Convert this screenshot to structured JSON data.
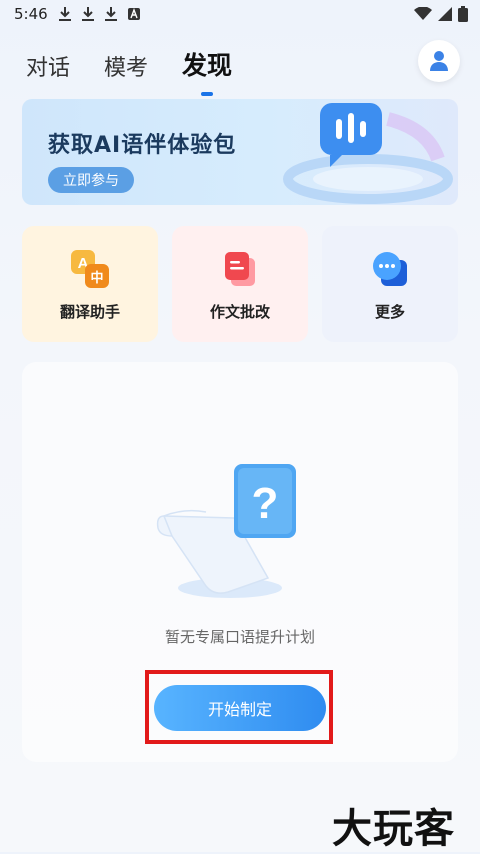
{
  "status_bar": {
    "time": "5:46"
  },
  "tabs": [
    {
      "label": "对话"
    },
    {
      "label": "模考"
    },
    {
      "label": "发现"
    }
  ],
  "banner": {
    "title": "获取AI语伴体验包",
    "button": "立即参与"
  },
  "features": [
    {
      "label": "翻译助手",
      "icon": "translate-icon"
    },
    {
      "label": "作文批改",
      "icon": "essay-icon"
    },
    {
      "label": "更多",
      "icon": "more-icon"
    }
  ],
  "plan": {
    "empty_text": "暂无专属口语提升计划",
    "start_button": "开始制定"
  },
  "watermark": "大玩客",
  "colors": {
    "accent": "#2f8cf0",
    "highlight": "#e21a1a"
  }
}
